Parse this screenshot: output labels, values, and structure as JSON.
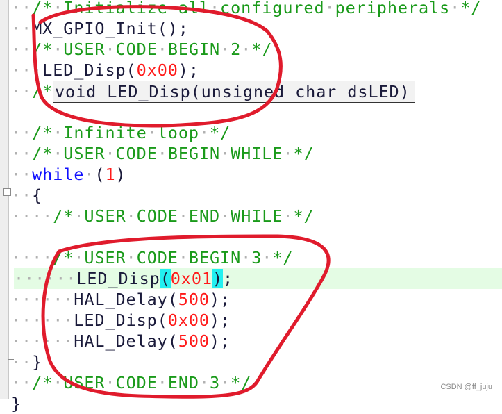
{
  "editor": {
    "lines": [
      {
        "indent": "··",
        "parts": [
          {
            "t": "/*·Initialize·all·configured·peripherals·*/",
            "c": "cm"
          }
        ]
      },
      {
        "indent": "··",
        "parts": [
          {
            "t": "MX_GPIO_Init();",
            "c": "id"
          }
        ]
      },
      {
        "indent": "··",
        "parts": [
          {
            "t": "/*·USER·CODE·BEGIN·2·*/",
            "c": "cm"
          }
        ]
      },
      {
        "indent": "···",
        "parts": [
          {
            "t": "LED_Disp(",
            "c": "id"
          },
          {
            "t": "0x00",
            "c": "num"
          },
          {
            "t": ");",
            "c": "id"
          }
        ]
      },
      {
        "indent": "··",
        "parts": [
          {
            "t": "/*",
            "c": "cm"
          }
        ]
      },
      {
        "indent": "",
        "parts": []
      },
      {
        "indent": "··",
        "parts": [
          {
            "t": "/*·Infinite·loop·*/",
            "c": "cm"
          }
        ]
      },
      {
        "indent": "··",
        "parts": [
          {
            "t": "/*·USER·CODE·BEGIN·WHILE·*/",
            "c": "cm"
          }
        ]
      },
      {
        "indent": "··",
        "parts": [
          {
            "t": "while",
            "c": "kw"
          },
          {
            "t": "·",
            "c": "ws"
          },
          {
            "t": "(",
            "c": "id"
          },
          {
            "t": "1",
            "c": "num"
          },
          {
            "t": ")",
            "c": "id"
          }
        ]
      },
      {
        "indent": "··",
        "parts": [
          {
            "t": "{",
            "c": "id"
          }
        ]
      },
      {
        "indent": "····",
        "parts": [
          {
            "t": "/*·USER·CODE·END·WHILE·*/",
            "c": "cm"
          }
        ]
      },
      {
        "indent": "",
        "parts": []
      },
      {
        "indent": "····",
        "parts": [
          {
            "t": "/*·USER·CODE·BEGIN·3·*/",
            "c": "cm"
          }
        ]
      },
      {
        "indent": "······",
        "highlight": true,
        "parts": [
          {
            "t": "LED_Disp",
            "c": "id"
          },
          {
            "t": "(",
            "c": "br"
          },
          {
            "t": "0x01",
            "c": "num"
          },
          {
            "t": ")",
            "c": "br"
          },
          {
            "t": ";",
            "c": "id"
          }
        ]
      },
      {
        "indent": "······",
        "parts": [
          {
            "t": "HAL_Delay(",
            "c": "id"
          },
          {
            "t": "500",
            "c": "num"
          },
          {
            "t": ");",
            "c": "id"
          }
        ]
      },
      {
        "indent": "······",
        "parts": [
          {
            "t": "LED_Disp(",
            "c": "id"
          },
          {
            "t": "0x00",
            "c": "num"
          },
          {
            "t": ");",
            "c": "id"
          }
        ]
      },
      {
        "indent": "······",
        "parts": [
          {
            "t": "HAL_Delay(",
            "c": "id"
          },
          {
            "t": "500",
            "c": "num"
          },
          {
            "t": ");",
            "c": "id"
          }
        ]
      },
      {
        "indent": "··",
        "parts": [
          {
            "t": "}",
            "c": "id"
          }
        ]
      },
      {
        "indent": "··",
        "parts": [
          {
            "t": "/*·USER·CODE·END·3·*/",
            "c": "cm"
          }
        ]
      },
      {
        "indent": "",
        "parts": [
          {
            "t": "}",
            "c": "id"
          }
        ]
      }
    ],
    "tooltip": "void LED_Disp(unsigned char dsLED)"
  },
  "annotations": {
    "color": "#e01b2c"
  },
  "watermark": "CSDN @ff_juju"
}
